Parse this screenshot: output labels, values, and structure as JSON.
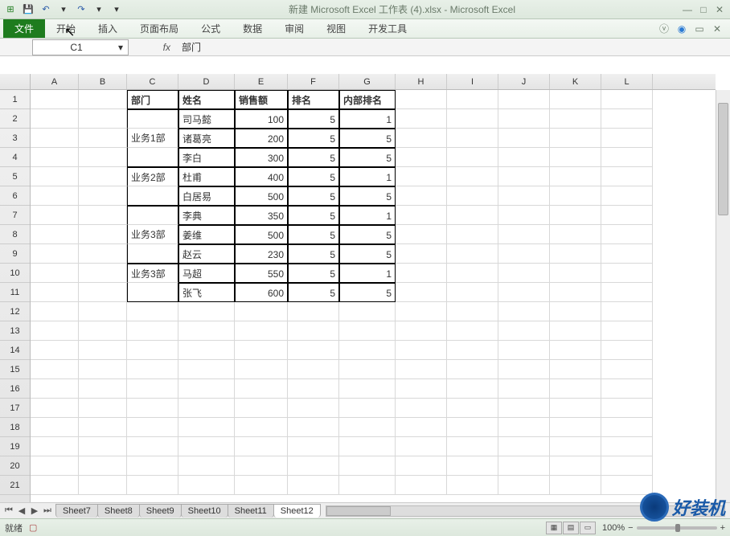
{
  "title": "新建 Microsoft Excel 工作表 (4).xlsx  -  Microsoft Excel",
  "ribbon": {
    "file": "文件",
    "tabs": [
      "开始",
      "插入",
      "页面布局",
      "公式",
      "数据",
      "审阅",
      "视图",
      "开发工具"
    ]
  },
  "namebox": "C1",
  "formula_fx": "fx",
  "formula_value": "部门",
  "columns": [
    "A",
    "B",
    "C",
    "D",
    "E",
    "F",
    "G",
    "H",
    "I",
    "J",
    "K",
    "L"
  ],
  "rows": [
    "1",
    "2",
    "3",
    "4",
    "5",
    "6",
    "7",
    "8",
    "9",
    "10",
    "11",
    "12",
    "13",
    "14",
    "15",
    "16",
    "17",
    "18",
    "19",
    "20",
    "21"
  ],
  "headers": {
    "c": "部门",
    "d": "姓名",
    "e": "销售额",
    "f": "排名",
    "g": "内部排名"
  },
  "groups": [
    {
      "dept": "业务1部",
      "rows": [
        {
          "name": "司马懿",
          "sales": 100,
          "rank": 5,
          "inner": 1
        },
        {
          "name": "诸葛亮",
          "sales": 200,
          "rank": 5,
          "inner": 5
        },
        {
          "name": "李白",
          "sales": 300,
          "rank": 5,
          "inner": 5
        }
      ]
    },
    {
      "dept": "业务2部",
      "rows": [
        {
          "name": "杜甫",
          "sales": 400,
          "rank": 5,
          "inner": 1
        },
        {
          "name": "白居易",
          "sales": 500,
          "rank": 5,
          "inner": 5
        }
      ]
    },
    {
      "dept": "业务3部",
      "rows": [
        {
          "name": "李典",
          "sales": 350,
          "rank": 5,
          "inner": 1
        },
        {
          "name": "姜维",
          "sales": 500,
          "rank": 5,
          "inner": 5
        },
        {
          "name": "赵云",
          "sales": 230,
          "rank": 5,
          "inner": 5
        }
      ]
    },
    {
      "dept": "业务3部",
      "rows": [
        {
          "name": "马超",
          "sales": 550,
          "rank": 5,
          "inner": 1
        },
        {
          "name": "张飞",
          "sales": 600,
          "rank": 5,
          "inner": 5
        }
      ]
    }
  ],
  "sheets": [
    "Sheet7",
    "Sheet8",
    "Sheet9",
    "Sheet10",
    "Sheet11",
    "Sheet12"
  ],
  "active_sheet": 5,
  "status": {
    "ready": "就绪",
    "zoom": "100%",
    "minus": "−",
    "plus": "+"
  },
  "watermark": "好装机"
}
